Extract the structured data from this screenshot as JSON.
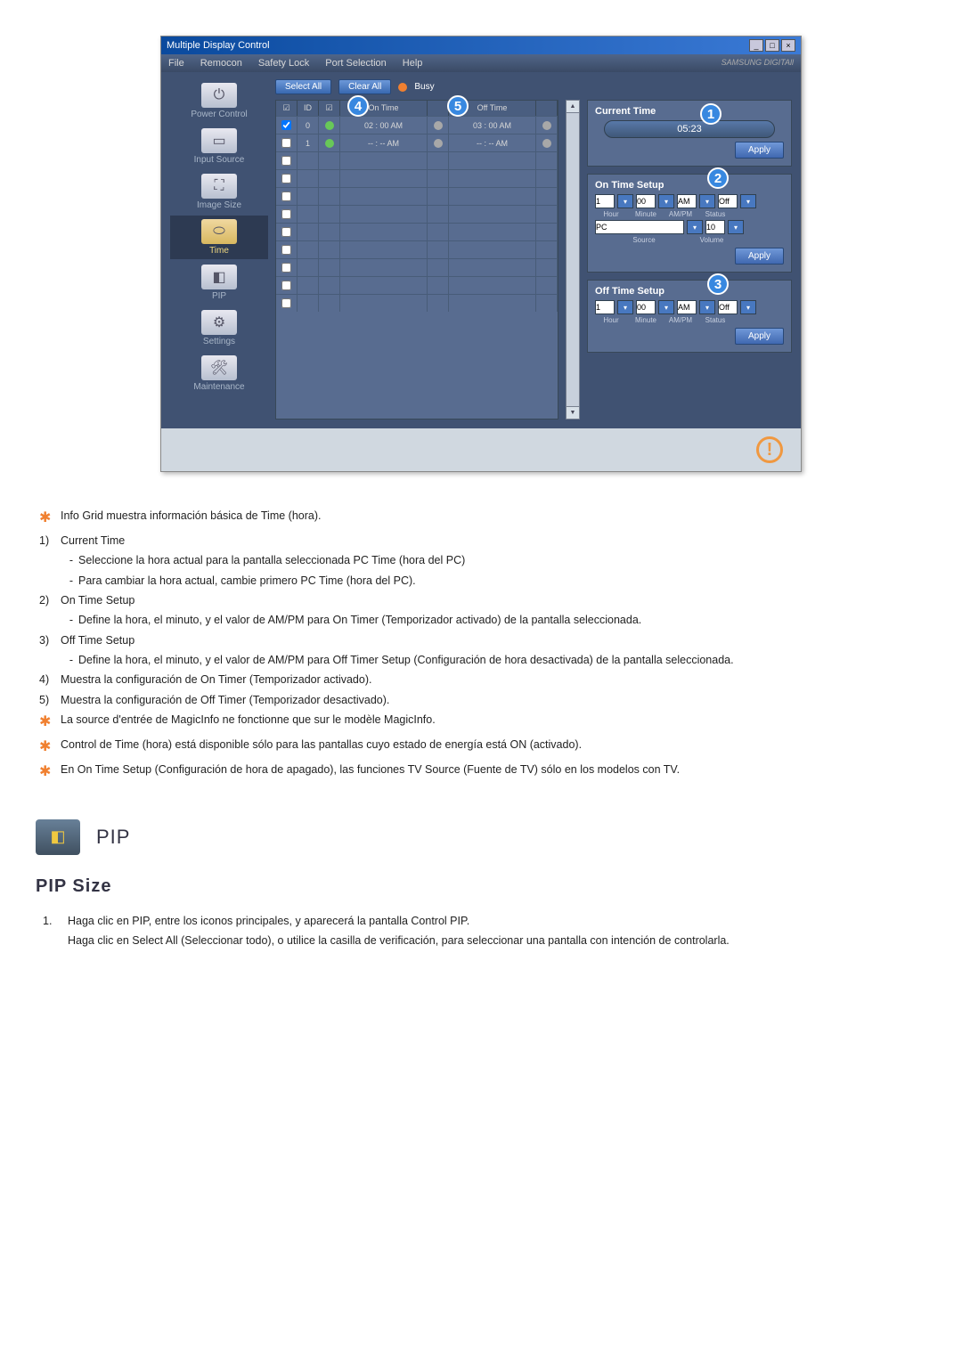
{
  "app": {
    "title": "Multiple Display Control",
    "minimize": "_",
    "maximize": "□",
    "close": "×",
    "brand": "SAMSUNG DIGITAll"
  },
  "menu": {
    "file": "File",
    "remocon": "Remocon",
    "safety_lock": "Safety Lock",
    "port_selection": "Port Selection",
    "help": "Help"
  },
  "sidebar": {
    "power": "Power Control",
    "input": "Input Source",
    "image": "Image Size",
    "time": "Time",
    "pip": "PIP",
    "settings": "Settings",
    "maintenance": "Maintenance"
  },
  "toolbar": {
    "select_all": "Select All",
    "clear_all": "Clear All",
    "busy": "Busy"
  },
  "grid": {
    "col_check": "☑",
    "col_id": "ID",
    "col_icon": "☑",
    "col_ontime": "On Time",
    "col_offtime": "Off Time",
    "rows": [
      {
        "id": "0",
        "on": "02 : 00 AM",
        "off": "03 : 00 AM",
        "green": true
      },
      {
        "id": "1",
        "on": "-- : -- AM",
        "off": "-- : -- AM",
        "green": true
      }
    ],
    "callout_4": "4",
    "callout_5": "5"
  },
  "panel": {
    "current_time": "Current Time",
    "time_value": "05:23",
    "on_time_setup": "On Time Setup",
    "off_time_setup": "Off Time Setup",
    "hour": "1",
    "minute": "00",
    "ampm": "AM",
    "status": "Off",
    "lbl_hour": "Hour",
    "lbl_minute": "Minute",
    "lbl_ampm": "AM/PM",
    "lbl_status": "Status",
    "source": "PC",
    "volume": "10",
    "lbl_source": "Source",
    "lbl_volume": "Volume",
    "apply": "Apply",
    "callout_1": "1",
    "callout_2": "2",
    "callout_3": "3"
  },
  "doc": {
    "line_star1": "Info Grid muestra información básica de Time (hora).",
    "line_1": "Current Time",
    "line_1a": "Seleccione la hora actual para la pantalla seleccionada PC Time (hora del PC)",
    "line_1b": "Para cambiar la hora actual, cambie primero PC Time (hora del PC).",
    "line_2": "On Time Setup",
    "line_2a": "Define la hora, el minuto, y el valor de AM/PM para On Timer (Temporizador activado) de la pantalla seleccionada.",
    "line_3": "Off Time Setup",
    "line_3a": "Define la hora, el minuto, y el valor de AM/PM para Off Timer Setup (Configuración de hora desactivada) de la pantalla seleccionada.",
    "line_4": "Muestra la configuración de On Timer (Temporizador activado).",
    "line_5": "Muestra la configuración de Off Timer (Temporizador desactivado).",
    "line_star2": "La source d'entrée de MagicInfo ne fonctionne que sur le modèle MagicInfo.",
    "line_star3": "Control de Time (hora) está disponible sólo para las pantallas cuyo estado de energía está ON (activado).",
    "line_star4": "En On Time Setup (Configuración de hora de apagado), las funciones TV Source (Fuente de TV) sólo en los modelos con TV."
  },
  "section": {
    "pip_title": "PIP",
    "pip_size": "PIP Size",
    "ol1": "Haga clic en PIP, entre los iconos principales, y aparecerá la pantalla Control PIP.",
    "ol1b": "Haga clic en Select All (Seleccionar todo), o utilice la casilla de verificación, para seleccionar una pantalla con intención de controlarla.",
    "n1": "1)",
    "n2": "2)",
    "n3": "3)",
    "n4": "4)",
    "n5": "5)",
    "num1": "1."
  }
}
